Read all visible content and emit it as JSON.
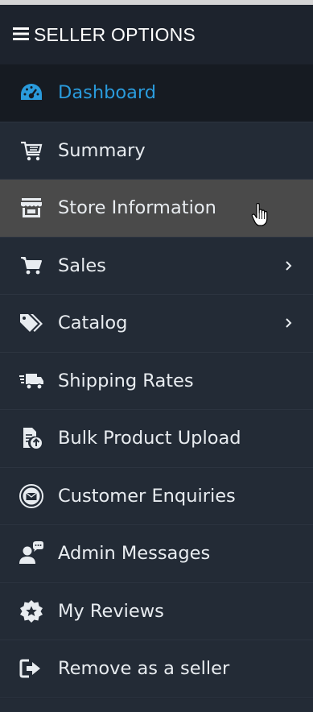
{
  "header": {
    "title": "SELLER OPTIONS",
    "icon": "hamburger-icon"
  },
  "menu": {
    "items": [
      {
        "label": "Dashboard",
        "icon": "dashboard-gauge-icon",
        "state": "active"
      },
      {
        "label": "Summary",
        "icon": "cart-list-icon"
      },
      {
        "label": "Store Information",
        "icon": "storefront-icon",
        "state": "hover"
      },
      {
        "label": "Sales",
        "icon": "shopping-cart-icon",
        "submenu": true
      },
      {
        "label": "Catalog",
        "icon": "tags-icon",
        "submenu": true
      },
      {
        "label": "Shipping Rates",
        "icon": "delivery-truck-icon"
      },
      {
        "label": "Bulk Product Upload",
        "icon": "file-upload-icon"
      },
      {
        "label": "Customer Enquiries",
        "icon": "envelope-circle-icon"
      },
      {
        "label": "Admin Messages",
        "icon": "user-chat-icon"
      },
      {
        "label": "My Reviews",
        "icon": "review-badge-icon"
      },
      {
        "label": "Remove as a seller",
        "icon": "sign-out-icon"
      }
    ]
  },
  "colors": {
    "background": "#232b36",
    "header": "#1d232d",
    "active_bg": "#161b22",
    "active_text": "#2a9bdc",
    "hover_bg": "#4a4a4a",
    "text": "#e8ecf0"
  }
}
